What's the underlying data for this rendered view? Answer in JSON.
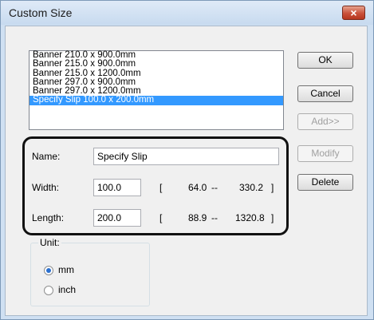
{
  "window": {
    "title": "Custom Size",
    "close_symbol": "×"
  },
  "list": {
    "items": [
      "Banner 210.0 x 900.0mm",
      "Banner 215.0 x 900.0mm",
      "Banner 215.0 x 1200.0mm",
      "Banner 297.0 x 900.0mm",
      "Banner 297.0 x 1200.0mm",
      "Specify Slip 100.0 x 200.0mm"
    ],
    "selected_index": 5
  },
  "buttons": {
    "ok": "OK",
    "cancel": "Cancel",
    "add": "Add>>",
    "modify": "Modify",
    "delete": "Delete"
  },
  "fields": {
    "name_label": "Name:",
    "name_value": "Specify Slip",
    "width_label": "Width:",
    "width_value": "100.0",
    "width_open": "[",
    "width_min": "64.0",
    "width_sep": "--",
    "width_max": "330.2",
    "width_close": "]",
    "length_label": "Length:",
    "length_value": "200.0",
    "length_open": "[",
    "length_min": "88.9",
    "length_sep": "--",
    "length_max": "1320.8",
    "length_close": "]"
  },
  "unit": {
    "label": "Unit:",
    "options": [
      "mm",
      "inch"
    ],
    "selected": "mm"
  },
  "colors": {
    "selection": "#3399ff",
    "close_button": "#c9513a"
  }
}
